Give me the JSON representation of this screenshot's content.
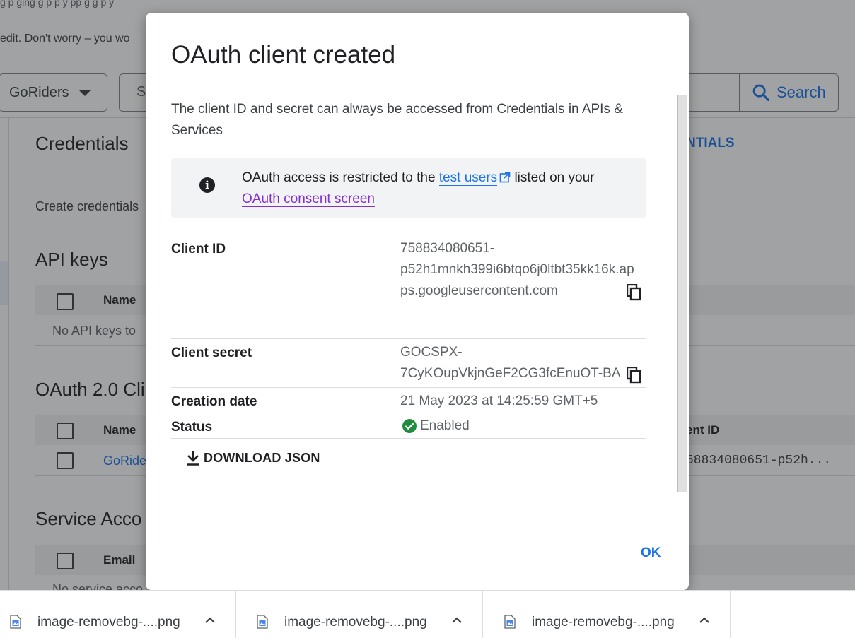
{
  "background": {
    "top_strip_text": "g          p              ging                   g                                   p                          p y              pp g g                    p y",
    "banner_text": "edit. Don't worry – you wo",
    "project_selector": "GoRiders",
    "search_placeholder": "S",
    "search_button": "Search",
    "page_title": "Credentials",
    "page_action_partial": "NTIALS",
    "create_text": "Create credentials",
    "api_keys": {
      "title": "API keys",
      "col_name": "Name",
      "empty": "No API keys to"
    },
    "oauth_clients": {
      "title": "OAuth 2.0 Cli",
      "col_name": "Name",
      "col_client_id": "ent ID",
      "row_name": "GoRide",
      "row_client_id": "58834080651-p52h..."
    },
    "service_accounts": {
      "title": "Service Acco",
      "col_email": "Email",
      "empty": "No service acco"
    }
  },
  "dialog": {
    "title": "OAuth client created",
    "description": "The client ID and secret can always be accessed from Credentials in APIs & Services",
    "info": {
      "text_before": "OAuth access is restricted to the ",
      "link_test_users": "test users",
      "text_after": " listed on your ",
      "link_consent": "OAuth consent screen"
    },
    "client_id_label": "Client ID",
    "client_id_lines": [
      "758834080651-",
      "p52h1mnkh399i6btqo6j0ltbt35kk16k.ap",
      "ps.googleusercontent.com"
    ],
    "client_secret_label": "Client secret",
    "client_secret_lines": [
      "GOCSPX-",
      "7CyKOupVkjnGeF2CG3fcEnuOT-BA"
    ],
    "creation_date_label": "Creation date",
    "creation_date": "21 May 2023 at 14:25:59 GMT+5",
    "status_label": "Status",
    "status": "Enabled",
    "download_button": "DOWNLOAD JSON",
    "ok_button": "OK"
  },
  "downloads": [
    {
      "name": "image-removebg-....png"
    },
    {
      "name": "image-removebg-....png"
    },
    {
      "name": "image-removebg-....png"
    }
  ],
  "colors": {
    "accent": "#1a73e8",
    "visited_link": "#8430ce",
    "success": "#1e8e3e",
    "scrim": "rgba(32,33,36,0.42)"
  },
  "icons": [
    "caret-down-icon",
    "search-icon",
    "info-icon",
    "external-link-icon",
    "copy-icon",
    "check-circle-icon",
    "download-icon",
    "file-image-icon",
    "chevron-up-icon"
  ]
}
